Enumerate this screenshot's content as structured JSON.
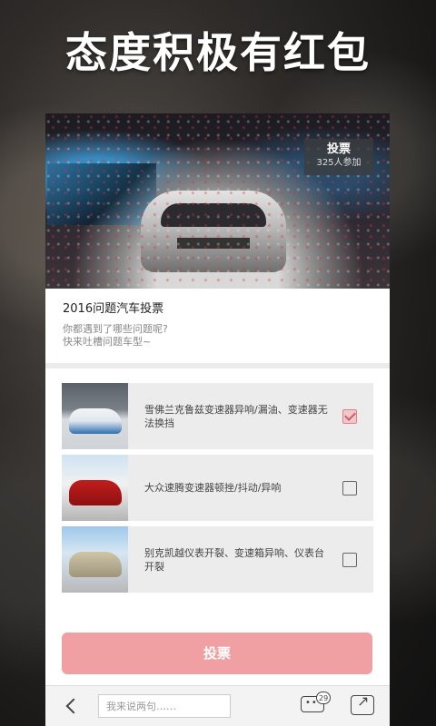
{
  "banner": {
    "headline": "态度积极有红包"
  },
  "hero": {
    "badge_title": "投票",
    "badge_count": "325人参加"
  },
  "poll": {
    "title": "2016问题汽车投票",
    "desc_line1": "你都遇到了哪些问题呢?",
    "desc_line2": "快来吐槽问题车型~"
  },
  "options": [
    {
      "text": "雪佛兰克鲁兹变速器异响/漏油、变速器无法换挡",
      "checked": true
    },
    {
      "text": "大众速腾变速器顿挫/抖动/异响",
      "checked": false
    },
    {
      "text": "别克凯越仪表开裂、变速箱异响、仪表台开裂",
      "checked": false
    }
  ],
  "submit_label": "投票",
  "bottom_bar": {
    "comment_placeholder": "我来说两句……",
    "comment_count": "29",
    "icons": [
      "back-icon",
      "comment-icon",
      "share-icon"
    ]
  },
  "colors": {
    "accent": "#f0a0a2",
    "check": "#d98389"
  }
}
